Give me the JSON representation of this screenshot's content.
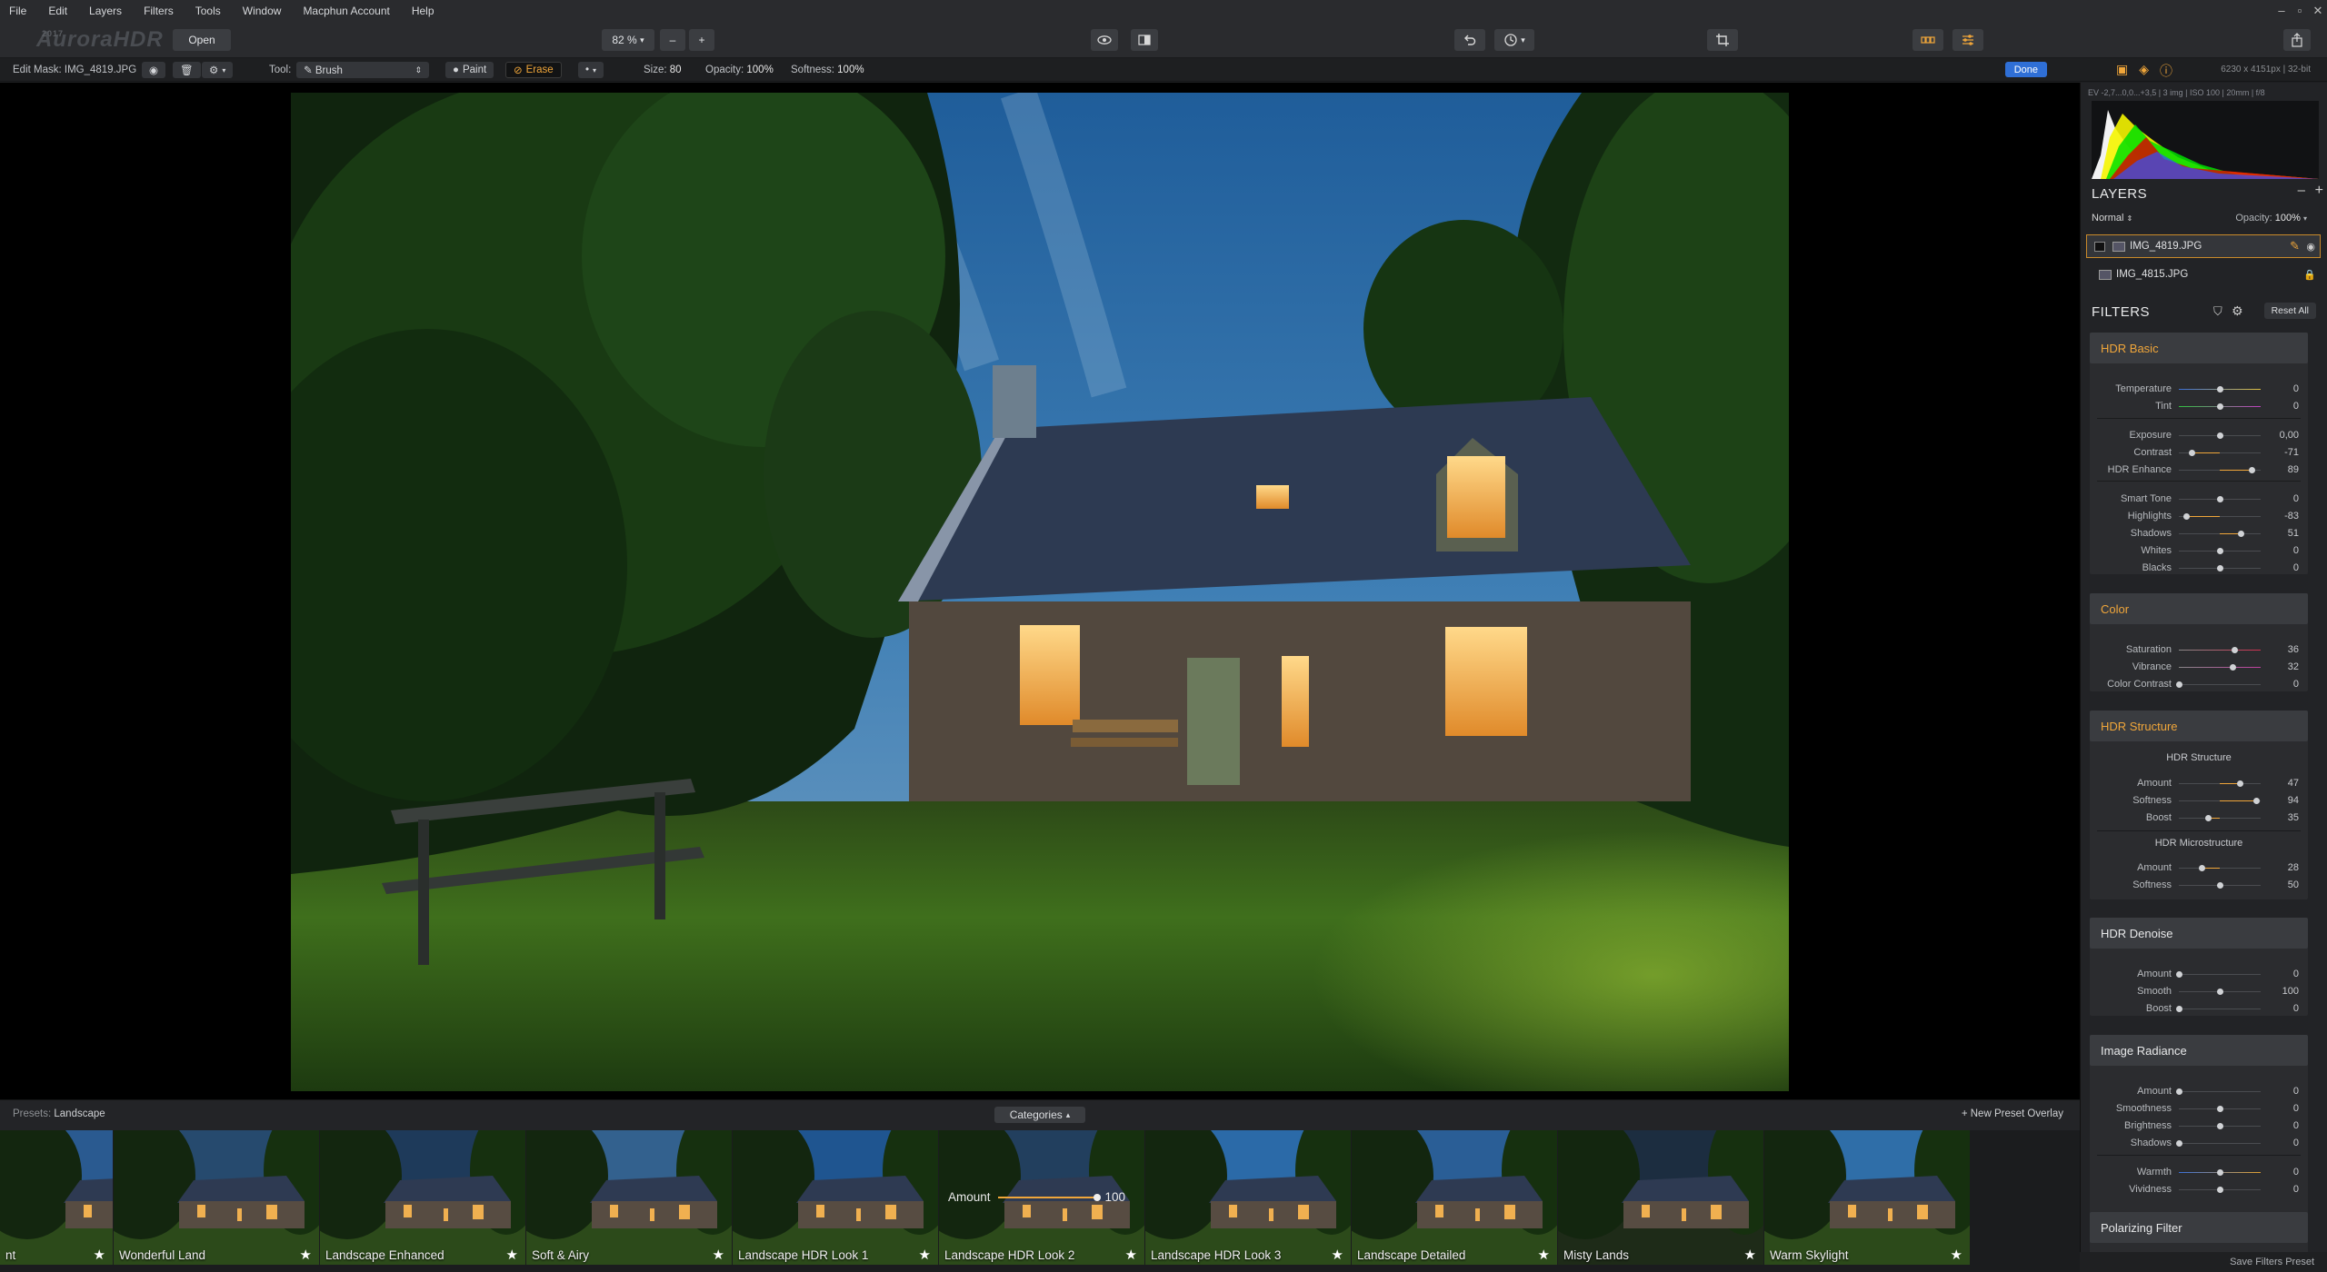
{
  "menu": [
    "File",
    "Edit",
    "Layers",
    "Filters",
    "Tools",
    "Window",
    "Macphun Account",
    "Help"
  ],
  "window_controls": [
    "–",
    "▫",
    "✕"
  ],
  "toolbar": {
    "logo": "AuroraHDR",
    "logo_year": "2017",
    "open_label": "Open",
    "zoom": "82 %",
    "zoom_out": "–",
    "zoom_in": "+"
  },
  "maskbar": {
    "edit_mask": "Edit Mask: IMG_4819.JPG",
    "tool_label": "Tool:",
    "tool_value": "Brush",
    "paint": "Paint",
    "erase": "Erase",
    "size_label": "Size:",
    "size_value": "80",
    "opacity_label": "Opacity:",
    "opacity_value": "100%",
    "softness_label": "Softness:",
    "softness_value": "100%",
    "done": "Done",
    "image_info": "6230 x 4151px | 32-bit"
  },
  "exif": "EV -2,7...0,0...+3,5  |  3 img  |  ISO 100  |  20mm  |  f/8",
  "layers": {
    "title": "LAYERS",
    "blend": "Normal",
    "opacity_label": "Opacity:",
    "opacity_value": "100%",
    "items": [
      {
        "name": "IMG_4819.JPG",
        "selected": true
      },
      {
        "name": "IMG_4815.JPG",
        "selected": false
      }
    ]
  },
  "filters": {
    "title": "FILTERS",
    "reset_all": "Reset All",
    "accent": "#f0a63a",
    "hdr_basic": {
      "title": "HDR Basic",
      "sliders": [
        {
          "label": "Temperature",
          "value": "0",
          "pos": 0.5
        },
        {
          "label": "Tint",
          "value": "0",
          "pos": 0.5
        },
        {
          "label": "Exposure",
          "value": "0,00",
          "pos": 0.5
        },
        {
          "label": "Contrast",
          "value": "-71",
          "pos": 0.15
        },
        {
          "label": "HDR Enhance",
          "value": "89",
          "pos": 0.89
        },
        {
          "label": "Smart Tone",
          "value": "0",
          "pos": 0.5
        },
        {
          "label": "Highlights",
          "value": "-83",
          "pos": 0.09
        },
        {
          "label": "Shadows",
          "value": "51",
          "pos": 0.76
        },
        {
          "label": "Whites",
          "value": "0",
          "pos": 0.5
        },
        {
          "label": "Blacks",
          "value": "0",
          "pos": 0.5
        }
      ]
    },
    "color": {
      "title": "Color",
      "sliders": [
        {
          "label": "Saturation",
          "value": "36",
          "pos": 0.68
        },
        {
          "label": "Vibrance",
          "value": "32",
          "pos": 0.66
        },
        {
          "label": "Color Contrast",
          "value": "0",
          "pos": 0.0
        }
      ]
    },
    "hdr_structure": {
      "title": "HDR Structure",
      "sub1": "HDR Structure",
      "sub2": "HDR Microstructure",
      "sliders1": [
        {
          "label": "Amount",
          "value": "47",
          "pos": 0.74
        },
        {
          "label": "Softness",
          "value": "94",
          "pos": 0.94
        },
        {
          "label": "Boost",
          "value": "35",
          "pos": 0.35
        }
      ],
      "sliders2": [
        {
          "label": "Amount",
          "value": "28",
          "pos": 0.28
        },
        {
          "label": "Softness",
          "value": "50",
          "pos": 0.5
        }
      ]
    },
    "hdr_denoise": {
      "title": "HDR Denoise",
      "sliders": [
        {
          "label": "Amount",
          "value": "0",
          "pos": 0.0
        },
        {
          "label": "Smooth",
          "value": "100",
          "pos": 0.5
        },
        {
          "label": "Boost",
          "value": "0",
          "pos": 0.0
        }
      ]
    },
    "image_radiance": {
      "title": "Image Radiance",
      "sliders": [
        {
          "label": "Amount",
          "value": "0",
          "pos": 0.0
        },
        {
          "label": "Smoothness",
          "value": "0",
          "pos": 0.5
        },
        {
          "label": "Brightness",
          "value": "0",
          "pos": 0.5
        },
        {
          "label": "Shadows",
          "value": "0",
          "pos": 0.0
        },
        {
          "label": "Warmth",
          "value": "0",
          "pos": 0.5
        },
        {
          "label": "Vividness",
          "value": "0",
          "pos": 0.5
        }
      ]
    },
    "polarizing": {
      "title": "Polarizing Filter"
    },
    "save_preset": "Save Filters Preset"
  },
  "presets": {
    "label": "Presets:",
    "category": "Landscape",
    "categories_btn": "Categories",
    "new_overlay": "+ New Preset Overlay",
    "amount_label": "Amount",
    "amount_value": "100",
    "items": [
      {
        "name": "nt"
      },
      {
        "name": "Wonderful Land"
      },
      {
        "name": "Landscape Enhanced"
      },
      {
        "name": "Soft & Airy"
      },
      {
        "name": "Landscape HDR Look 1"
      },
      {
        "name": "Landscape HDR Look 2"
      },
      {
        "name": "Landscape HDR Look 3"
      },
      {
        "name": "Landscape Detailed"
      },
      {
        "name": "Misty Lands"
      },
      {
        "name": "Warm Skylight"
      }
    ]
  }
}
